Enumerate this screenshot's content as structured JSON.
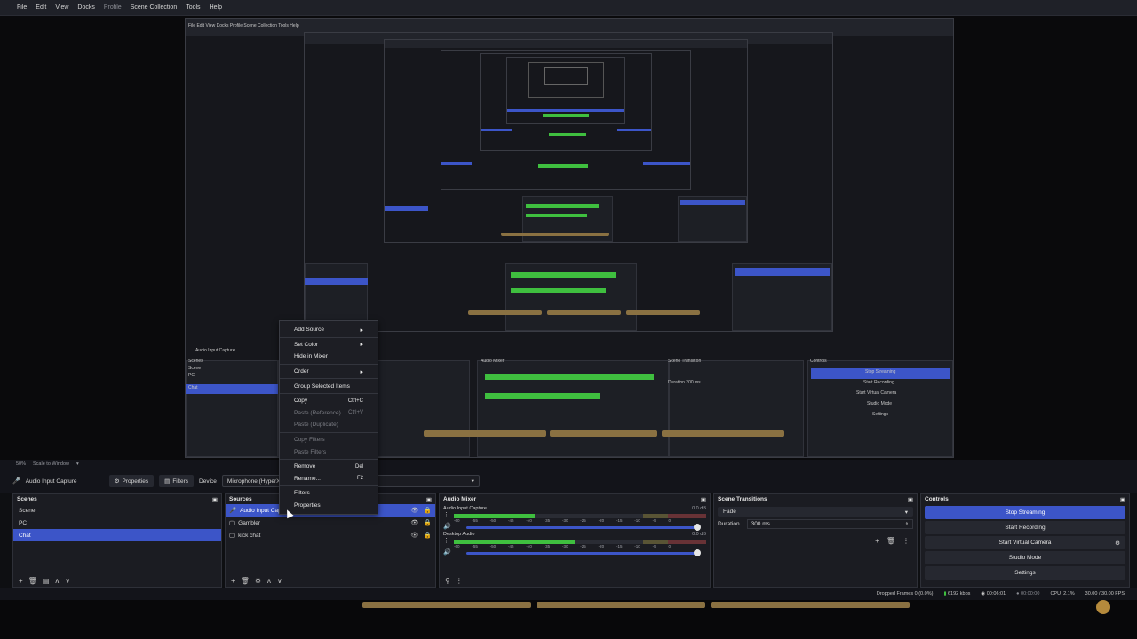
{
  "menubar": [
    {
      "label": "File",
      "dim": false
    },
    {
      "label": "Edit",
      "dim": false
    },
    {
      "label": "View",
      "dim": false
    },
    {
      "label": "Docks",
      "dim": false
    },
    {
      "label": "Profile",
      "dim": true
    },
    {
      "label": "Scene Collection",
      "dim": false
    },
    {
      "label": "Tools",
      "dim": false
    },
    {
      "label": "Help",
      "dim": false
    }
  ],
  "zoom": {
    "value": "50%",
    "scale_label": "Scale to Window"
  },
  "source_bar": {
    "selected_source": "Audio Input Capture",
    "properties_label": "Properties",
    "filters_label": "Filters",
    "device_label": "Device",
    "device_value": "Microphone (HyperX C"
  },
  "scenes": {
    "title": "Scenes",
    "items": [
      {
        "label": "Scene",
        "selected": false
      },
      {
        "label": "PC",
        "selected": false
      },
      {
        "label": "Chat",
        "selected": true
      }
    ]
  },
  "sources": {
    "title": "Sources",
    "items": [
      {
        "label": "Audio Input Capture",
        "selected": true
      },
      {
        "label": "Gambler",
        "selected": false
      },
      {
        "label": "kick chat",
        "selected": false
      }
    ]
  },
  "mixer": {
    "title": "Audio Mixer",
    "channels": [
      {
        "name": "Audio Input Capture",
        "db": "0.0 dB",
        "level_pct": 32
      },
      {
        "name": "Desktop Audio",
        "db": "0.0 dB",
        "level_pct": 48
      }
    ],
    "ticks": [
      "-60",
      "-55",
      "-50",
      "-45",
      "-40",
      "-35",
      "-30",
      "-25",
      "-20",
      "-15",
      "-10",
      "-5",
      "0"
    ]
  },
  "transitions": {
    "title": "Scene Transitions",
    "type": "Fade",
    "duration_label": "Duration",
    "duration_value": "300 ms"
  },
  "controls": {
    "title": "Controls",
    "buttons": [
      {
        "label": "Stop Streaming",
        "primary": true
      },
      {
        "label": "Start Recording",
        "primary": false
      },
      {
        "label": "Start Virtual Camera",
        "primary": false
      },
      {
        "label": "Studio Mode",
        "primary": false
      },
      {
        "label": "Settings",
        "primary": false
      }
    ]
  },
  "status": {
    "dropped": "Dropped Frames 0 (0.0%)",
    "kbps": "6192 kbps",
    "live_time": "00:06:01",
    "rec_time": "00:00:00",
    "cpu": "CPU: 2.1%",
    "fps": "30.00 / 30.00 FPS"
  },
  "context_menu": {
    "items": [
      {
        "label": "Add Source",
        "shortcut": "",
        "submenu": true,
        "disabled": false
      },
      {
        "sep": true
      },
      {
        "label": "Set Color",
        "shortcut": "",
        "submenu": true,
        "disabled": false
      },
      {
        "label": "Hide in Mixer",
        "shortcut": "",
        "submenu": false,
        "disabled": false
      },
      {
        "sep": true
      },
      {
        "label": "Order",
        "shortcut": "",
        "submenu": true,
        "disabled": false
      },
      {
        "sep": true
      },
      {
        "label": "Group Selected Items",
        "shortcut": "",
        "submenu": false,
        "disabled": false
      },
      {
        "sep": true
      },
      {
        "label": "Copy",
        "shortcut": "Ctrl+C",
        "submenu": false,
        "disabled": false
      },
      {
        "label": "Paste (Reference)",
        "shortcut": "Ctrl+V",
        "submenu": false,
        "disabled": true
      },
      {
        "label": "Paste (Duplicate)",
        "shortcut": "",
        "submenu": false,
        "disabled": true
      },
      {
        "sep": true
      },
      {
        "label": "Copy Filters",
        "shortcut": "",
        "submenu": false,
        "disabled": true
      },
      {
        "label": "Paste Filters",
        "shortcut": "",
        "submenu": false,
        "disabled": true
      },
      {
        "sep": true
      },
      {
        "label": "Remove",
        "shortcut": "Del",
        "submenu": false,
        "disabled": false
      },
      {
        "label": "Rename...",
        "shortcut": "F2",
        "submenu": false,
        "disabled": false
      },
      {
        "sep": true
      },
      {
        "label": "Filters",
        "shortcut": "",
        "submenu": false,
        "disabled": false
      },
      {
        "label": "Properties",
        "shortcut": "",
        "submenu": false,
        "disabled": false
      }
    ]
  }
}
